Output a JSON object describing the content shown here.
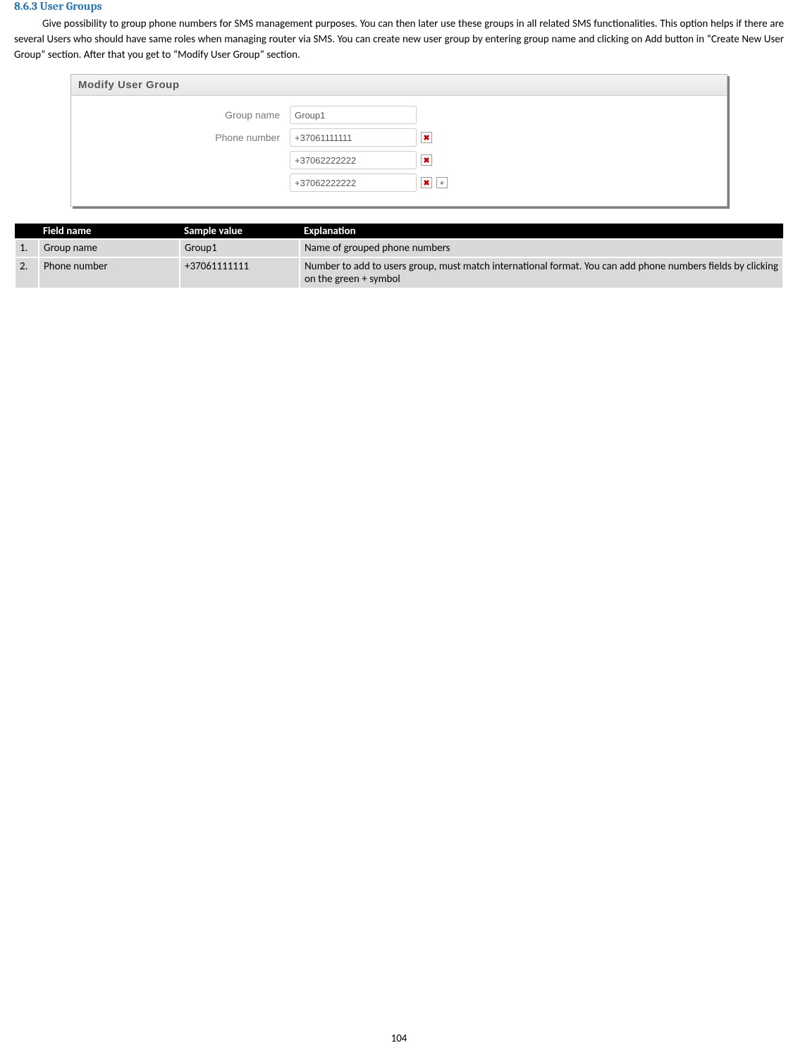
{
  "heading": "8.6.3  User Groups",
  "paragraph": "Give possibility to group phone numbers for SMS management purposes. You can then later use these groups in all related SMS functionalities. This option helps if there are several Users who should have same roles when managing router via SMS. You can create new user group by entering group name and clicking on Add button in “Create New User Group” section. After that you get to “Modify User Group” section.",
  "panel": {
    "title": "Modify User Group",
    "fields": {
      "group_name_label": "Group name",
      "group_name_value": "Group1",
      "phone_number_label": "Phone number",
      "phone_numbers": [
        "+37061111111",
        "+37062222222",
        "+37062222222"
      ]
    }
  },
  "table": {
    "headers": [
      "",
      "Field name",
      "Sample value",
      "Explanation"
    ],
    "rows": [
      {
        "num": "1.",
        "field": "Group name",
        "sample": "Group1",
        "explanation": "Name of grouped phone numbers"
      },
      {
        "num": "2.",
        "field": "Phone number",
        "sample": "+37061111111",
        "explanation": "Number to add to users group, must match international format. You can add phone numbers fields by clicking on the green + symbol"
      }
    ]
  },
  "page_number": "104"
}
